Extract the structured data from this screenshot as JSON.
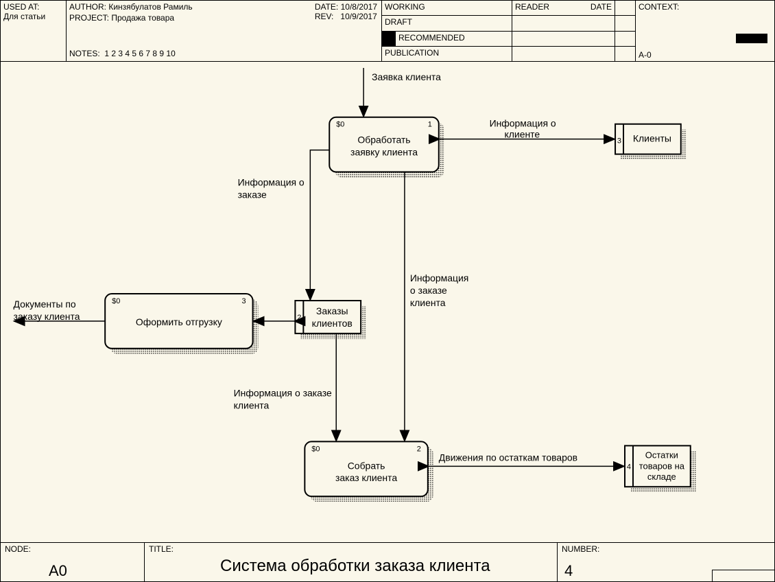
{
  "header": {
    "usedAtLabel": "USED AT:",
    "usedAtValue": "Для статьи",
    "authorLabel": "AUTHOR:",
    "authorValue": "Кинзябулатов Рамиль",
    "projectLabel": "PROJECT:",
    "projectValue": "Продажа товара",
    "dateLabel": "DATE:",
    "dateValue": "10/8/2017",
    "revLabel": "REV:",
    "revValue": "10/9/2017",
    "notesLabel": "NOTES:",
    "notesValues": "1  2  3  4  5  6  7  8  9  10",
    "status": {
      "working": "WORKING",
      "draft": "DRAFT",
      "recommended": "RECOMMENDED",
      "publication": "PUBLICATION",
      "reader": "READER",
      "date": "DATE"
    },
    "contextLabel": "CONTEXT:",
    "contextNode": "A-0"
  },
  "footer": {
    "nodeLabel": "NODE:",
    "nodeValue": "A0",
    "titleLabel": "TITLE:",
    "titleValue": "Система обработки заказа клиента",
    "numberLabel": "NUMBER:",
    "numberValue": "4"
  },
  "boxes": {
    "b1": {
      "cost": "$0",
      "num": "1",
      "line1": "Обработать",
      "line2": "заявку клиента"
    },
    "b3": {
      "cost": "$0",
      "num": "3",
      "line1": "Оформить отгрузку"
    },
    "b2": {
      "cost": "$0",
      "num": "2",
      "line1": "Собрать",
      "line2": "заказ клиента"
    },
    "ds_clients": {
      "num": "3",
      "label": "Клиенты"
    },
    "ds_orders": {
      "num": "2",
      "line1": "Заказы",
      "line2": "клиентов"
    },
    "ds_stock": {
      "num": "4",
      "line1": "Остатки",
      "line2": "товаров на",
      "line3": "складе"
    }
  },
  "arrows": {
    "input_top": "Заявка клиента",
    "to_clients1": "Информация о",
    "to_clients2": "клиенте",
    "info_order1": "Информация о",
    "info_order2": "заказе",
    "info_order_client1": "Информация",
    "info_order_client2": "о заказе",
    "info_order_client3": "клиента",
    "docs1": "Документы по",
    "docs2": "заказу клиента",
    "info_order_client_b1": "Информация о заказе",
    "info_order_client_b2": "клиента",
    "stock_move": "Движения по остаткам товаров"
  }
}
